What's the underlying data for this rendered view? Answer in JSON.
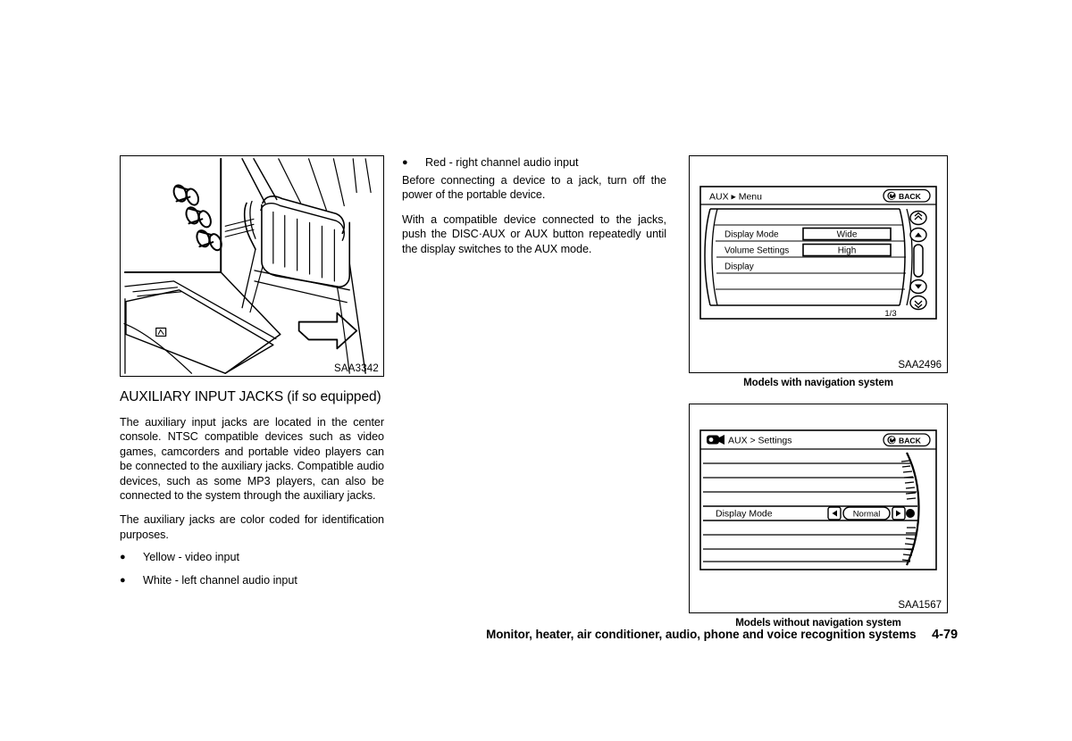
{
  "page": {
    "footer_text": "Monitor, heater, air conditioner, audio, phone and voice recognition systems",
    "page_number": "4-79"
  },
  "left_column": {
    "figure": {
      "code": "SAA3342",
      "description": "Line drawing of center console with three auxiliary input jacks and an arrow pointing to the console lid"
    },
    "heading": "AUXILIARY INPUT JACKS (if so equipped)",
    "paragraphs": [
      "The auxiliary input jacks are located in the center console. NTSC compatible devices such as video games, camcorders and portable video players can be connected to the auxiliary jacks. Compatible audio devices, such as some MP3 players, can also be connected to the system through the auxiliary jacks.",
      "The auxiliary jacks are color coded for identification purposes."
    ],
    "bullets": [
      {
        "marker": "●",
        "text": "Yellow - video input"
      },
      {
        "marker": "●",
        "text": "White - left channel audio input"
      }
    ]
  },
  "middle_column": {
    "bullets": [
      {
        "marker": "●",
        "text": "Red - right channel audio input"
      }
    ],
    "paragraphs": [
      "Before connecting a device to a jack, turn off the power of the portable device.",
      "With a compatible device connected to the jacks, push the DISC·AUX or AUX button repeatedly until the display switches to the AUX mode."
    ]
  },
  "right_column": {
    "nav_screen": {
      "code": "SAA2496",
      "caption": "Models with navigation system",
      "title": "AUX ▸ Menu",
      "back_label": "BACK",
      "rows": [
        {
          "label": "Display Mode",
          "value": "Wide"
        },
        {
          "label": "Volume Settings",
          "value": "High"
        },
        {
          "label": "Display",
          "value": ""
        }
      ],
      "page_indicator": "1/3",
      "scroll_icons": [
        "double-up-arrow",
        "up-arrow",
        "scroll-thumb",
        "down-arrow",
        "double-down-arrow"
      ]
    },
    "nonav_screen": {
      "code": "SAA1567",
      "caption": "Models without navigation system",
      "title": "AUX > Settings",
      "back_label": "BACK",
      "rows": [
        {
          "label": "Display Mode",
          "value": "Normal",
          "prev": "◀",
          "next": "▶"
        }
      ]
    }
  }
}
